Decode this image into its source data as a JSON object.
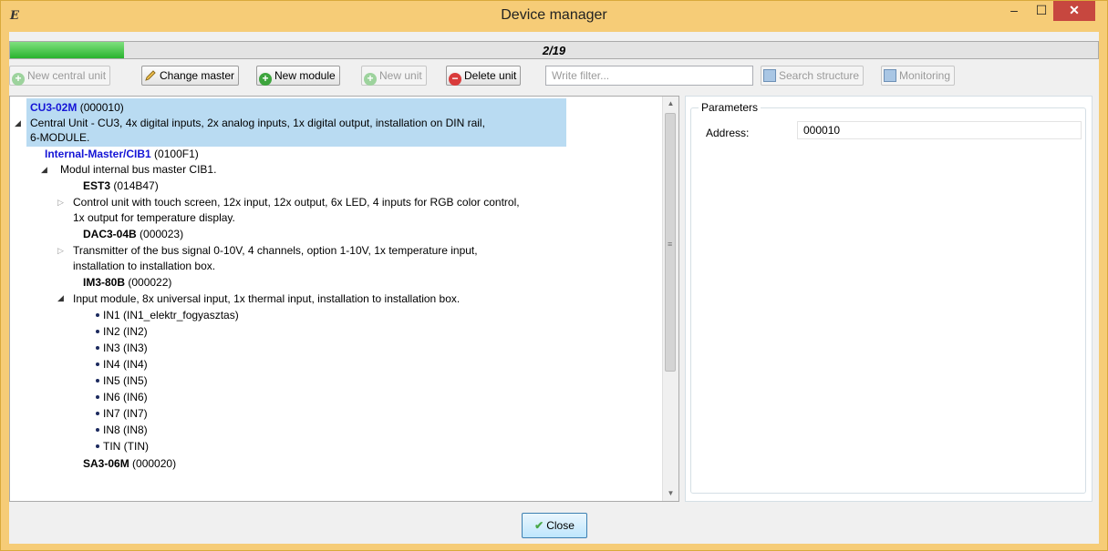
{
  "window": {
    "title": "Device manager",
    "app_icon": "E",
    "minimize": "–",
    "maximize": "☐",
    "close": "✕"
  },
  "progress": {
    "label": "2/19",
    "current": 2,
    "total": 19,
    "fraction": 0.105,
    "fill_color": "#29b32e"
  },
  "toolbar": {
    "new_central_unit": "New central unit",
    "change_master": "Change master",
    "new_module": "New module",
    "new_unit": "New unit",
    "delete_unit": "Delete unit",
    "filter_placeholder": "Write filter...",
    "search_structure": "Search structure",
    "monitoring": "Monitoring"
  },
  "tree": {
    "root": {
      "name": "CU3-02M",
      "address": "(000010)",
      "desc1": "Central Unit - CU3, 4x digital inputs, 2x analog inputs, 1x digital output, installation on DIN rail,",
      "desc2": "6-MODULE."
    },
    "master": {
      "name": "Internal-Master/CIB1",
      "address": "(0100F1)",
      "desc": "Modul internal bus master CIB1."
    },
    "est3": {
      "name": "EST3",
      "address": "(014B47)",
      "desc1": "Control unit with touch screen, 12x input, 12x output, 6x LED, 4 inputs for RGB color control,",
      "desc2": "1x output for temperature display."
    },
    "dac3": {
      "name": "DAC3-04B",
      "address": "(000023)",
      "desc1": "Transmitter of the bus signal 0-10V, 4 channels, option 1-10V, 1x temperature input,",
      "desc2": "installation to installation box."
    },
    "im3": {
      "name": "IM3-80B",
      "address": "(000022)",
      "desc": "Input module, 8x universal input, 1x thermal input, installation to installation box.",
      "inputs": [
        "IN1 (IN1_elektr_fogyasztas)",
        "IN2 (IN2)",
        "IN3 (IN3)",
        "IN4 (IN4)",
        "IN5 (IN5)",
        "IN6 (IN6)",
        "IN7 (IN7)",
        "IN8 (IN8)",
        "TIN (TIN)"
      ]
    },
    "sa3": {
      "name": "SA3-06M",
      "address": "(000020)"
    }
  },
  "parameters": {
    "legend": "Parameters",
    "address_label": "Address:",
    "address_value": "000010"
  },
  "footer": {
    "close_label": "Close"
  }
}
